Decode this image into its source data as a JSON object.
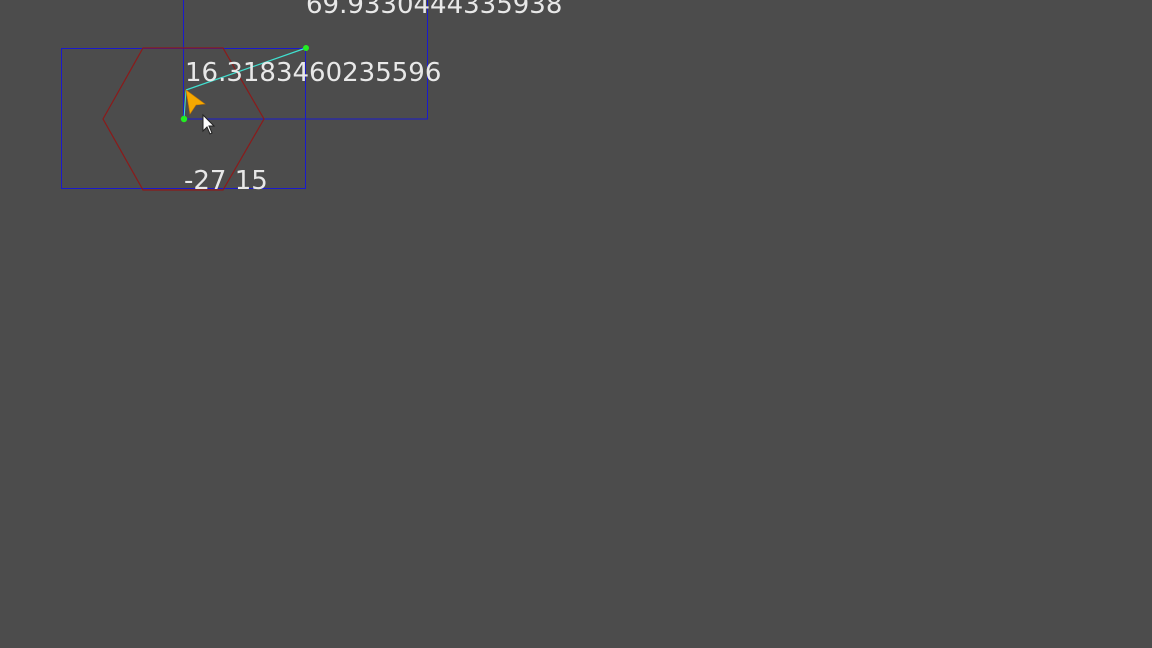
{
  "scene": {
    "background_color": "#4c4c4c",
    "labels": {
      "top": "69.9330444335938",
      "middle": "16.3183460235596",
      "bottom": "-27 15"
    },
    "colors": {
      "bounding_box": "#1a1acc",
      "hexagon": "#8b1a1a",
      "vector_line": "#40e0d0",
      "point": "#22ee22",
      "arrow": "#f5a800"
    },
    "icons": {
      "player_arrow": "orange-arrow-icon",
      "cursor": "mouse-pointer-icon"
    }
  }
}
